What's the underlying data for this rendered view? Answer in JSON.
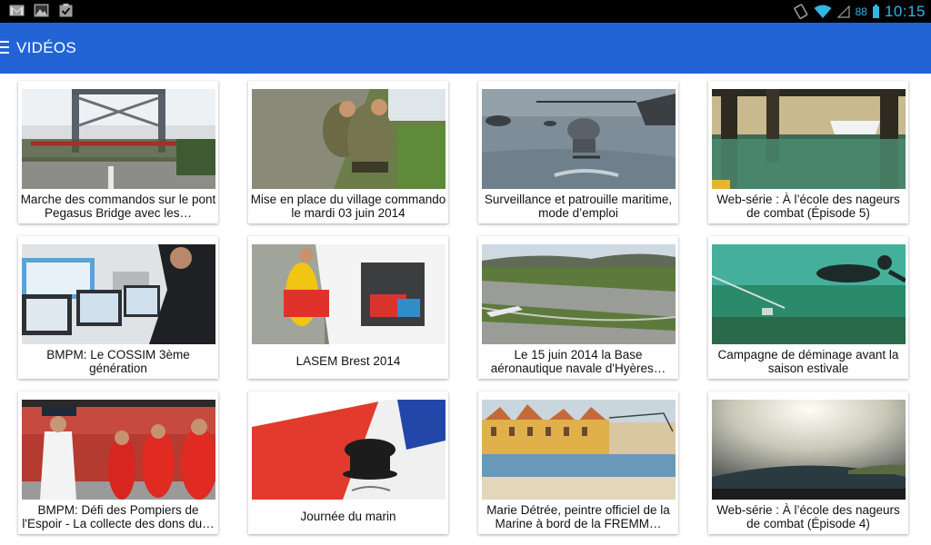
{
  "status_bar": {
    "left_icons": [
      "gmail-icon",
      "gallery-icon",
      "clipboard-check-icon"
    ],
    "right_icons": [
      "rotation-lock-icon",
      "wifi-icon",
      "signal-icon",
      "battery-icon"
    ],
    "battery": "88",
    "time": "10:15"
  },
  "app_bar": {
    "title": "VIDÉOS",
    "color": "#2264d6"
  },
  "videos": [
    {
      "title": "Marche des commandos sur le pont Pegasus Bridge avec les…"
    },
    {
      "title": "Mise en place du village commando le mardi 03 juin 2014"
    },
    {
      "title": "Surveillance et patrouille maritime, mode d’emploi"
    },
    {
      "title": "Web-série : À l’école des nageurs de combat (Épisode 5)"
    },
    {
      "title": "BMPM: Le COSSIM 3ème génération"
    },
    {
      "title": "LASEM Brest 2014"
    },
    {
      "title": "Le 15 juin 2014 la Base aéronautique navale d'Hyères…"
    },
    {
      "title": "Campagne de déminage avant la saison estivale"
    },
    {
      "title": "BMPM: Défi des Pompiers de l'Espoir - La collecte des dons du…"
    },
    {
      "title": "Journée du marin"
    },
    {
      "title": "Marie Détrée, peintre officiel de la Marine à bord de la FREMM…"
    },
    {
      "title": "Web-série : À l’école des nageurs de combat (Épisode 4)"
    }
  ]
}
